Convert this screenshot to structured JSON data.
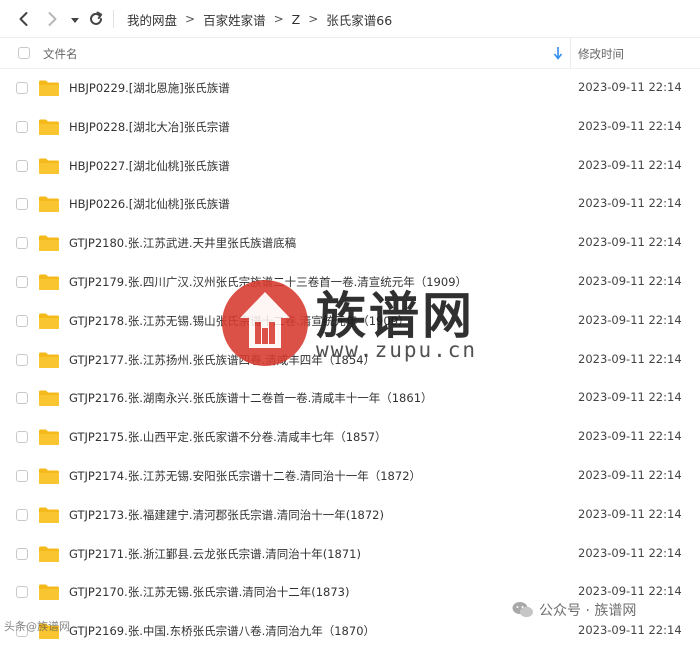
{
  "toolbar": {
    "icons": [
      "back-icon",
      "forward-icon",
      "dropdown-icon",
      "refresh-icon"
    ],
    "breadcrumb": [
      "我的网盘",
      "百家姓家谱",
      "Z",
      "张氏家谱66"
    ],
    "separator": ">"
  },
  "header": {
    "name_label": "文件名",
    "date_label": "修改时间",
    "sort_icon": "sort-down-arrow-icon"
  },
  "colors": {
    "folder": "#f9c632",
    "folder_tab": "#f4b91a",
    "sort_arrow": "#2f8cf0",
    "watermark_red": "#d83a2e"
  },
  "files": [
    {
      "name": "HBJP0229.[湖北恩施]张氏族谱",
      "date": "2023-09-11 22:14"
    },
    {
      "name": "HBJP0228.[湖北大冶]张氏宗谱",
      "date": "2023-09-11 22:14"
    },
    {
      "name": "HBJP0227.[湖北仙桃]张氏族谱",
      "date": "2023-09-11 22:14"
    },
    {
      "name": "HBJP0226.[湖北仙桃]张氏族谱",
      "date": "2023-09-11 22:14"
    },
    {
      "name": "GTJP2180.张.江苏武进.天井里张氏族谱底稿",
      "date": "2023-09-11 22:14"
    },
    {
      "name": "GTJP2179.张.四川广汉.汉州张氏宗族谱二十三卷首一卷.清宣统元年（1909）",
      "date": "2023-09-11 22:14"
    },
    {
      "name": "GTJP2178.张.江苏无锡.锡山张氏宗谱十二卷.清宣统元年（1909）",
      "date": "2023-09-11 22:14"
    },
    {
      "name": "GTJP2177.张.江苏扬州.张氏族谱四卷.清咸丰四年（1854）",
      "date": "2023-09-11 22:14"
    },
    {
      "name": "GTJP2176.张.湖南永兴.张氏族谱十二卷首一卷.清咸丰十一年（1861）",
      "date": "2023-09-11 22:14"
    },
    {
      "name": "GTJP2175.张.山西平定.张氏家谱不分卷.清咸丰七年（1857）",
      "date": "2023-09-11 22:14"
    },
    {
      "name": "GTJP2174.张.江苏无锡.安阳张氏宗谱十二卷.清同治十一年（1872）",
      "date": "2023-09-11 22:14"
    },
    {
      "name": "GTJP2173.张.福建建宁.清河郡张氏宗谱.清同治十一年(1872)",
      "date": "2023-09-11 22:14"
    },
    {
      "name": "GTJP2171.张.浙江鄞县.云龙张氏宗谱.清同治十年(1871)",
      "date": "2023-09-11 22:14"
    },
    {
      "name": "GTJP2170.张.江苏无锡.张氏宗谱.清同治十二年(1873)",
      "date": "2023-09-11 22:14"
    },
    {
      "name": "GTJP2169.张.中国.东桥张氏宗谱八卷.清同治九年（1870）",
      "date": "2023-09-11 22:14"
    }
  ],
  "watermark": {
    "title": "族谱网",
    "url": "www.zupu.cn",
    "account": "公众号 · 族谱网",
    "corner_text": "头条@族谱网"
  }
}
